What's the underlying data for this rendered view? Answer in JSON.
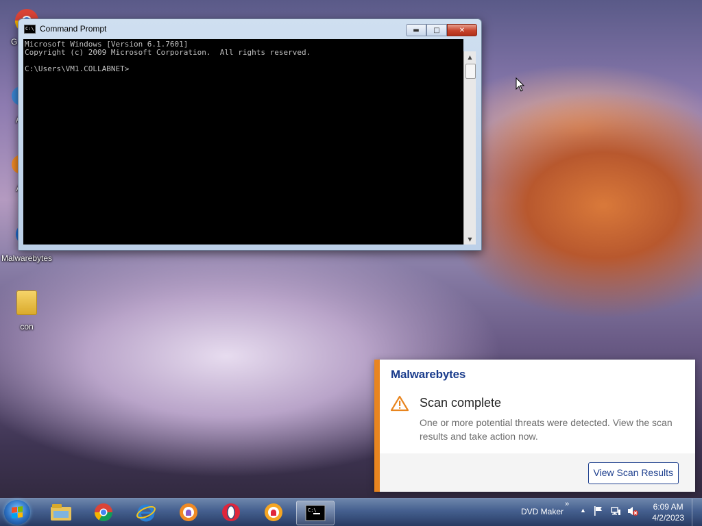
{
  "desktop": {
    "icons": [
      {
        "label": "G…",
        "icon": "chrome-icon"
      },
      {
        "label": "AV…",
        "icon": "avast-icon"
      },
      {
        "label": "Ava…",
        "icon": "avast-browser-icon"
      },
      {
        "label": "Malwarebytes",
        "icon": "malwarebytes-icon"
      },
      {
        "label": "con",
        "icon": "folder-icon"
      }
    ]
  },
  "cmd": {
    "title": "Command Prompt",
    "lines": [
      "Microsoft Windows [Version 6.1.7601]",
      "Copyright (c) 2009 Microsoft Corporation.  All rights reserved.",
      "",
      "C:\\Users\\VM1.COLLABNET>"
    ]
  },
  "toast": {
    "brand": "Malwarebytes",
    "title": "Scan complete",
    "message": "One or more potential threats were detected. View the scan results and take action now.",
    "button": "View Scan Results",
    "accent": "#e8851f",
    "brand_color": "#1a3c8c"
  },
  "taskbar": {
    "pinned": [
      "explorer-icon",
      "chrome-icon",
      "internet-explorer-icon",
      "avast-secure-browser-icon",
      "opera-icon",
      "avast-browser-icon",
      "command-prompt-icon"
    ],
    "tray_label": "DVD Maker",
    "tray_overflow": "»",
    "time": "6:09 AM",
    "date": "4/2/2023"
  }
}
